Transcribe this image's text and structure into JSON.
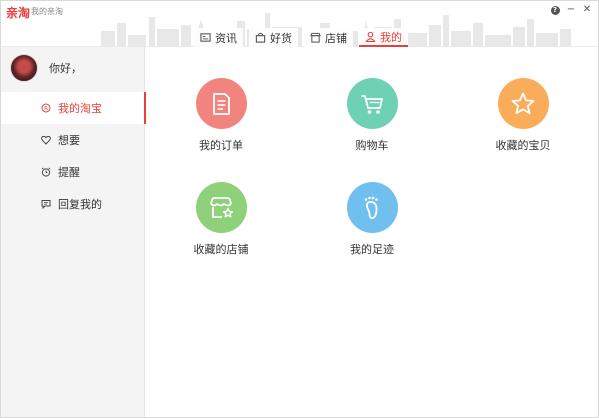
{
  "app": {
    "logo": "亲淘",
    "title": "我的亲淘"
  },
  "window_controls": [
    {
      "name": "help",
      "glyph": "?"
    },
    {
      "name": "minimize",
      "glyph": "−"
    },
    {
      "name": "close",
      "glyph": "✕"
    }
  ],
  "tabs": [
    {
      "label": "资讯",
      "icon": "news-icon",
      "active": false
    },
    {
      "label": "好货",
      "icon": "bag-icon",
      "active": false
    },
    {
      "label": "店铺",
      "icon": "store-icon",
      "active": false
    },
    {
      "label": "我的",
      "icon": "person-icon",
      "active": true
    }
  ],
  "profile": {
    "greeting": "你好，"
  },
  "menu": [
    {
      "label": "我的淘宝",
      "icon": "taobao-icon",
      "active": true
    },
    {
      "label": "想要",
      "icon": "heart-icon",
      "active": false
    },
    {
      "label": "提醒",
      "icon": "alarm-icon",
      "active": false
    },
    {
      "label": "回复我的",
      "icon": "comment-icon",
      "active": false
    }
  ],
  "features": [
    {
      "label": "我的订单",
      "icon": "order-icon",
      "color": "#f2847f"
    },
    {
      "label": "购物车",
      "icon": "cart-icon",
      "color": "#6ed1b4"
    },
    {
      "label": "收藏的宝贝",
      "icon": "star-icon",
      "color": "#f9ad5a"
    },
    {
      "label": "收藏的店铺",
      "icon": "shop-star-icon",
      "color": "#8ed17a"
    },
    {
      "label": "我的足迹",
      "icon": "footprint-icon",
      "color": "#6fc0ee"
    }
  ],
  "colors": {
    "accent": "#e5403a",
    "sidebar_bg": "#f4f4f4"
  }
}
